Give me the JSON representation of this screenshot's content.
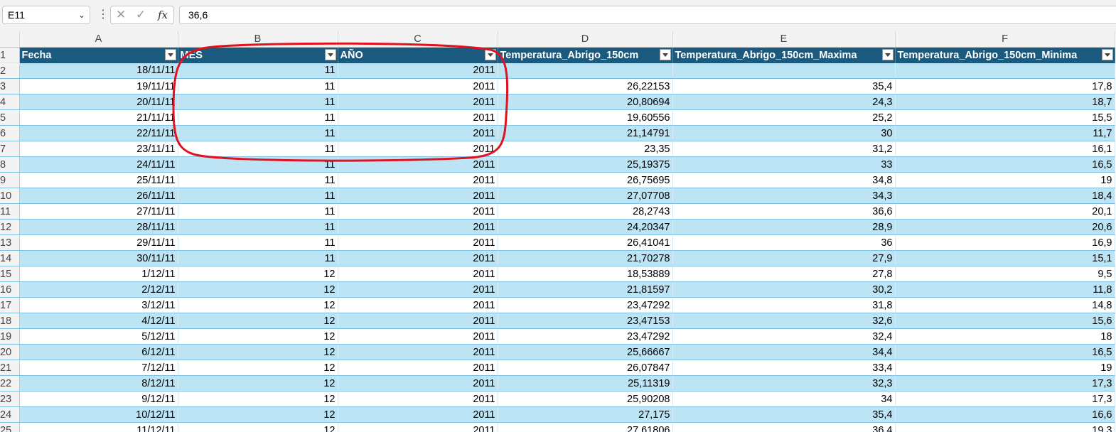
{
  "formula_bar": {
    "cell_ref": "E11",
    "formula": "36,6",
    "cancel_symbol": "✕",
    "enter_symbol": "✓",
    "fx_label": "fx"
  },
  "columns": [
    "A",
    "B",
    "C",
    "D",
    "E",
    "F"
  ],
  "headers": [
    "Fecha",
    "MES",
    "AÑO",
    "Temperatura_Abrigo_150cm",
    "Temperatura_Abrigo_150cm_Maxima",
    "Temperatura_Abrigo_150cm_Minima"
  ],
  "rows": [
    [
      "18/11/11",
      "11",
      "2011",
      "",
      "",
      ""
    ],
    [
      "19/11/11",
      "11",
      "2011",
      "26,22153",
      "35,4",
      "17,8"
    ],
    [
      "20/11/11",
      "11",
      "2011",
      "20,80694",
      "24,3",
      "18,7"
    ],
    [
      "21/11/11",
      "11",
      "2011",
      "19,60556",
      "25,2",
      "15,5"
    ],
    [
      "22/11/11",
      "11",
      "2011",
      "21,14791",
      "30",
      "11,7"
    ],
    [
      "23/11/11",
      "11",
      "2011",
      "23,35",
      "31,2",
      "16,1"
    ],
    [
      "24/11/11",
      "11",
      "2011",
      "25,19375",
      "33",
      "16,5"
    ],
    [
      "25/11/11",
      "11",
      "2011",
      "26,75695",
      "34,8",
      "19"
    ],
    [
      "26/11/11",
      "11",
      "2011",
      "27,07708",
      "34,3",
      "18,4"
    ],
    [
      "27/11/11",
      "11",
      "2011",
      "28,2743",
      "36,6",
      "20,1"
    ],
    [
      "28/11/11",
      "11",
      "2011",
      "24,20347",
      "28,9",
      "20,6"
    ],
    [
      "29/11/11",
      "11",
      "2011",
      "26,41041",
      "36",
      "16,9"
    ],
    [
      "30/11/11",
      "11",
      "2011",
      "21,70278",
      "27,9",
      "15,1"
    ],
    [
      "1/12/11",
      "12",
      "2011",
      "18,53889",
      "27,8",
      "9,5"
    ],
    [
      "2/12/11",
      "12",
      "2011",
      "21,81597",
      "30,2",
      "11,8"
    ],
    [
      "3/12/11",
      "12",
      "2011",
      "23,47292",
      "31,8",
      "14,8"
    ],
    [
      "4/12/11",
      "12",
      "2011",
      "23,47153",
      "32,6",
      "15,6"
    ],
    [
      "5/12/11",
      "12",
      "2011",
      "23,47292",
      "32,4",
      "18"
    ],
    [
      "6/12/11",
      "12",
      "2011",
      "25,66667",
      "34,4",
      "16,5"
    ],
    [
      "7/12/11",
      "12",
      "2011",
      "26,07847",
      "33,4",
      "19"
    ],
    [
      "8/12/11",
      "12",
      "2011",
      "25,11319",
      "32,3",
      "17,3"
    ],
    [
      "9/12/11",
      "12",
      "2011",
      "25,90208",
      "34",
      "17,3"
    ],
    [
      "10/12/11",
      "12",
      "2011",
      "27,175",
      "35,4",
      "16,6"
    ],
    [
      "11/12/11",
      "12",
      "2011",
      "27,61806",
      "36,4",
      "19,3"
    ]
  ],
  "annotation_color": "#e0121f",
  "header_fill_color": "#1b5a7f",
  "band_fill_color": "#bde4f5"
}
